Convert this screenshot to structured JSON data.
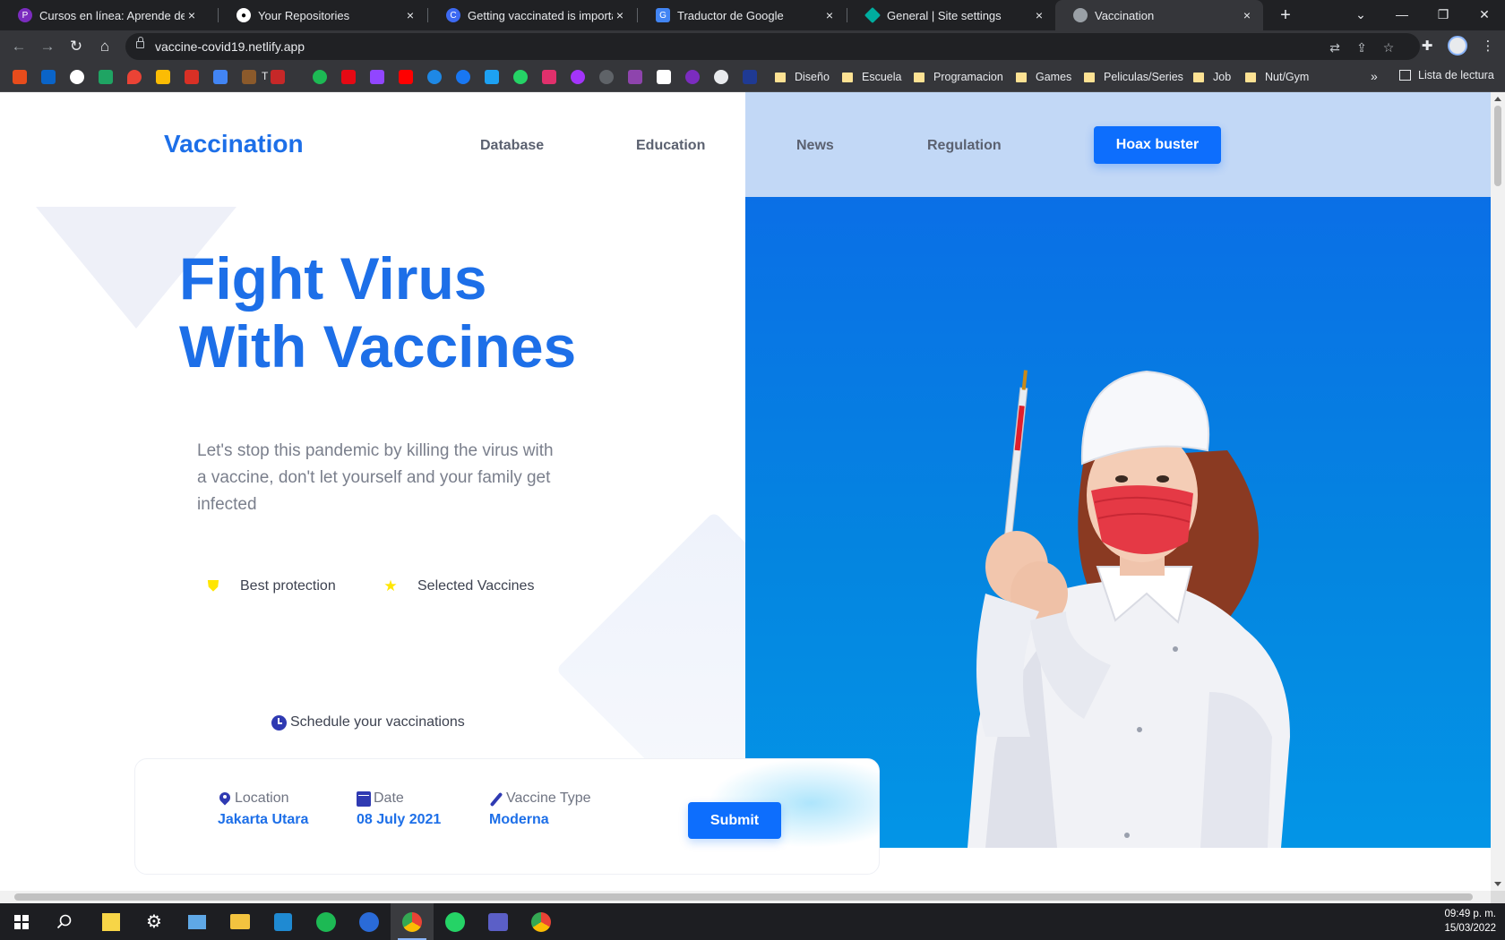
{
  "browser": {
    "tabs": [
      {
        "title": "Cursos en línea: Aprende de todo",
        "favicon_color": "#7b2cbf"
      },
      {
        "title": "Your Repositories",
        "favicon_color": "#ffffff"
      },
      {
        "title": "Getting vaccinated is important",
        "favicon_color": "#3d6af2"
      },
      {
        "title": "Traductor de Google",
        "favicon_color": "#4285f4"
      },
      {
        "title": "General | Site settings",
        "favicon_color": "#00ad9f"
      },
      {
        "title": "Vaccination",
        "favicon_color": "#9aa0a6"
      }
    ],
    "close_glyph": "×",
    "new_tab_glyph": "+",
    "url": "vaccine-covid19.netlify.app",
    "bookmark_folders": [
      "Diseño",
      "Escuela",
      "Programacion",
      "Games",
      "Peliculas/Series",
      "Job",
      "Nut/Gym"
    ],
    "bookmark_more": "»",
    "reading_list": "Lista de lectura",
    "bookmark_t_label": "T"
  },
  "site": {
    "logo": "Vaccination",
    "nav": [
      "Database",
      "Education",
      "News",
      "Regulation"
    ],
    "cta": "Hoax buster",
    "headline_line1": "Fight Virus",
    "headline_line2": "With Vaccines",
    "subtitle": "Let's stop this pandemic by killing the virus with a vaccine, don't let yourself and your family get infected",
    "features": [
      "Best protection",
      "Selected Vaccines"
    ],
    "schedule_label": "Schedule your vaccinations",
    "form": {
      "location_label": "Location",
      "location_value": "Jakarta Utara",
      "date_label": "Date",
      "date_value": "08 July 2021",
      "type_label": "Vaccine Type",
      "type_value": "Moderna",
      "submit": "Submit"
    }
  },
  "taskbar": {
    "time": "09:49 p. m.",
    "date": "15/03/2022"
  },
  "colors": {
    "brand_blue": "#1d6fe8",
    "button_blue": "#0d6efd",
    "hero_blue": "#0a6fe6",
    "nav_bg": "#c2d8f6",
    "feature_yellow": "#ffe600"
  }
}
